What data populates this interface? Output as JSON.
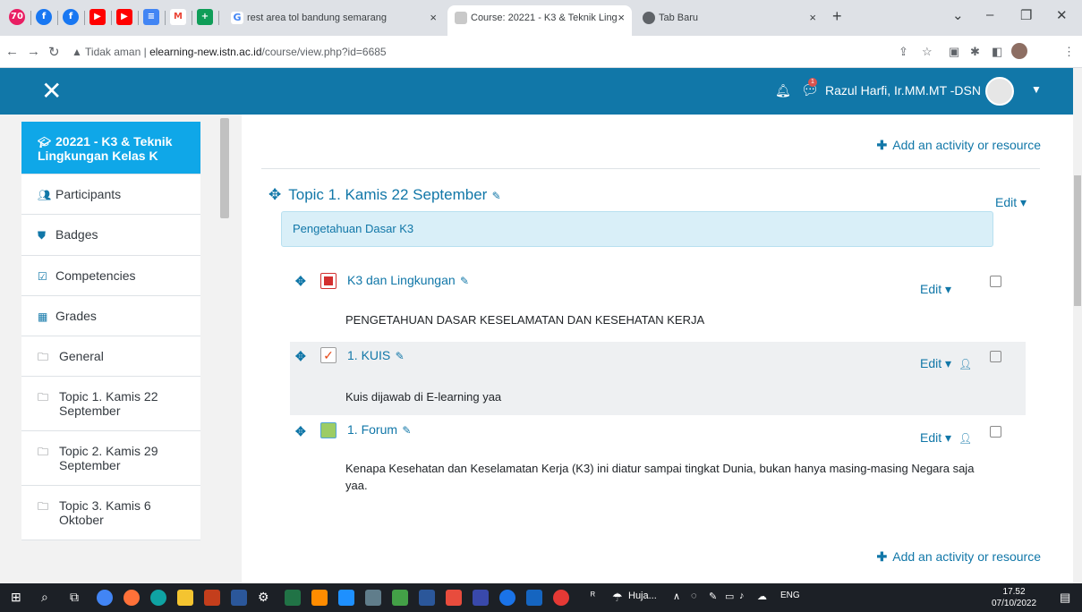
{
  "browser": {
    "tabs": [
      {
        "title": "rest area tol bandung semarang",
        "close": "×"
      },
      {
        "title": "Course: 20221 - K3 & Teknik Ling",
        "close": "×"
      },
      {
        "title": "Tab Baru",
        "close": "×"
      }
    ],
    "new_tab": "+",
    "address_warning": "Tidak aman",
    "address_separator": "|",
    "url_host": "elearning-new.istn.ac.id",
    "url_path": "/course/view.php?id=6685"
  },
  "header": {
    "notification_count": "1",
    "user_name": "Razul Harfi, Ir.MM.MT -DSN"
  },
  "sidebar": {
    "course": "20221 - K3 & Teknik Lingkungan Kelas K",
    "items": [
      {
        "label": "Participants",
        "icon": "users-icon"
      },
      {
        "label": "Badges",
        "icon": "shield-icon"
      },
      {
        "label": "Competencies",
        "icon": "checkbox-icon"
      },
      {
        "label": "Grades",
        "icon": "table-icon"
      },
      {
        "label": "General",
        "icon": "folder-icon"
      },
      {
        "label": "Topic 1. Kamis 22 September",
        "icon": "folder-icon"
      },
      {
        "label": "Topic 2. Kamis 29 September",
        "icon": "folder-icon"
      },
      {
        "label": "Topic 3. Kamis 6 Oktober",
        "icon": "folder-icon"
      }
    ]
  },
  "main": {
    "add_activity": "Add an activity or resource",
    "topic_title": "Topic 1. Kamis 22 September",
    "edit_label": "Edit",
    "summary": "Pengetahuan Dasar K3",
    "activities": [
      {
        "name": "K3 dan Lingkungan",
        "type": "pdf-icon",
        "description": "PENGETAHUAN DASAR KESELAMATAN DAN KESEHATAN KERJA"
      },
      {
        "name": "1. KUIS",
        "type": "quiz-icon",
        "description": "Kuis dijawab di E-learning yaa"
      },
      {
        "name": "1. Forum",
        "type": "forum-icon",
        "description": "Kenapa Kesehatan dan Keselamatan Kerja (K3) ini  diatur sampai tingkat Dunia, bukan hanya masing-masing Negara saja yaa."
      }
    ]
  },
  "taskbar": {
    "weather": "Huja...",
    "language": "ENG",
    "time": "17.52",
    "date": "07/10/2022"
  },
  "colors": {
    "accent": "#1177a8",
    "active_nav": "#0fa7e8"
  }
}
